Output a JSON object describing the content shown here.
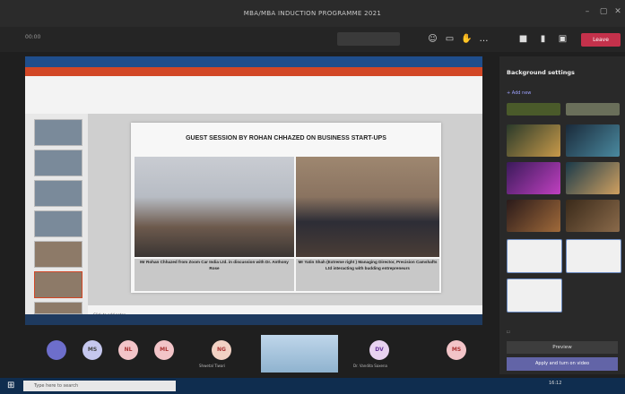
{
  "window": {
    "title": "MBA/MBA INDUCTION PROGRAMME 2021"
  },
  "toolbar": {
    "timer": "00:00",
    "leave_label": "Leave",
    "icons": [
      "people-icon",
      "chat-icon",
      "reactions-icon",
      "more-icon",
      "camera-icon",
      "mic-icon",
      "share-icon",
      "phone-icon"
    ]
  },
  "slide": {
    "title": "GUEST SESSION BY ROHAN CHHAZED ON BUSINESS START-UPS",
    "caption_left": "Mr Rohan Chhazed from Zoom Car India Ltd. in discussion with Dr. Anthony Rose",
    "caption_right": "Mr Yatin Shah (Extreme right ) Managing Director, Precision Camshafts Ltd interacting with budding entrepreneurs"
  },
  "ppt": {
    "notes_placeholder": "Click to add notes"
  },
  "bg_panel": {
    "title": "Background settings",
    "add_new": "+ Add new",
    "preview_label": "Preview",
    "apply_label": "Apply and turn on video"
  },
  "participants": [
    {
      "initials": "",
      "color": "#6d6ecb"
    },
    {
      "initials": "MS",
      "color": "#c5c7ee"
    },
    {
      "initials": "NL",
      "color": "#f2c4c8"
    },
    {
      "initials": "ML",
      "color": "#f2c4c8"
    },
    {
      "initials": "NG",
      "color": "#f2d2c4"
    },
    {
      "initials": "DV",
      "color": "#e8d2f0"
    },
    {
      "initials": "MS",
      "color": "#f2c4c8"
    }
  ],
  "names": {
    "p1": "Shwetal Tiwari",
    "p2": "Dr. Vandita Saxena"
  },
  "taskbar": {
    "search_placeholder": "Type here to search",
    "time": "16:12"
  }
}
